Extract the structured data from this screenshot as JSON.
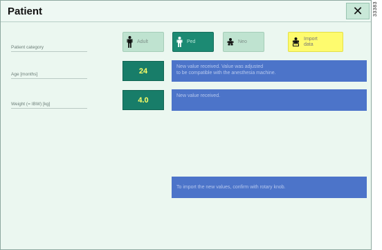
{
  "dialog": {
    "title": "Patient",
    "close_label": "✕"
  },
  "doc_id": "33383",
  "labels": {
    "patient_category": "Patient category",
    "age": "Age [months]",
    "weight": "Weight (= IBW) [kg]"
  },
  "categories": {
    "adult": "Adult",
    "ped": "Ped",
    "neo": "Neo",
    "import": [
      "Import",
      "data"
    ],
    "selected": "Ped"
  },
  "values": {
    "age": "24",
    "weight": "4.0"
  },
  "messages": {
    "age": [
      "New value received. Value was adjusted",
      "to be compatible with the anesthesia machine."
    ],
    "weight": "New value received.",
    "confirm": "To import the new values, confirm with rotary knob."
  },
  "colors": {
    "background": "#ebf7f0",
    "selected_button": "#1c8a73",
    "value_box": "#187d69",
    "value_text": "#ffff66",
    "message": "#4c74c9",
    "import_button": "#fefb6e"
  }
}
